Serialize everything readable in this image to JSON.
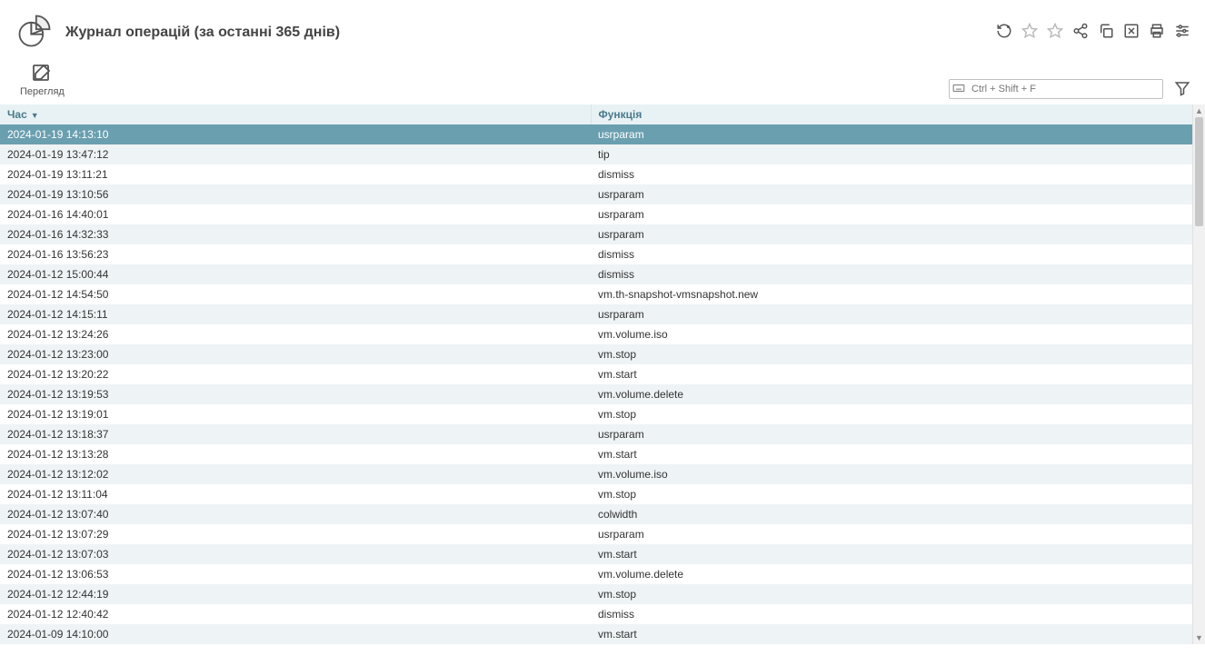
{
  "page_title": "Журнал операцій (за останні 365 днів)",
  "toolbar": {
    "view_label": "Перегляд"
  },
  "search": {
    "placeholder": "Ctrl + Shift + F"
  },
  "columns": {
    "time": "Час",
    "func": "Функція"
  },
  "rows": [
    {
      "time": "2024-01-19 14:13:10",
      "func": "usrparam",
      "selected": true
    },
    {
      "time": "2024-01-19 13:47:12",
      "func": "tip"
    },
    {
      "time": "2024-01-19 13:11:21",
      "func": "dismiss"
    },
    {
      "time": "2024-01-19 13:10:56",
      "func": "usrparam"
    },
    {
      "time": "2024-01-16 14:40:01",
      "func": "usrparam"
    },
    {
      "time": "2024-01-16 14:32:33",
      "func": "usrparam"
    },
    {
      "time": "2024-01-16 13:56:23",
      "func": "dismiss"
    },
    {
      "time": "2024-01-12 15:00:44",
      "func": "dismiss"
    },
    {
      "time": "2024-01-12 14:54:50",
      "func": "vm.th-snapshot-vmsnapshot.new"
    },
    {
      "time": "2024-01-12 14:15:11",
      "func": "usrparam"
    },
    {
      "time": "2024-01-12 13:24:26",
      "func": "vm.volume.iso"
    },
    {
      "time": "2024-01-12 13:23:00",
      "func": "vm.stop"
    },
    {
      "time": "2024-01-12 13:20:22",
      "func": "vm.start"
    },
    {
      "time": "2024-01-12 13:19:53",
      "func": "vm.volume.delete"
    },
    {
      "time": "2024-01-12 13:19:01",
      "func": "vm.stop"
    },
    {
      "time": "2024-01-12 13:18:37",
      "func": "usrparam"
    },
    {
      "time": "2024-01-12 13:13:28",
      "func": "vm.start"
    },
    {
      "time": "2024-01-12 13:12:02",
      "func": "vm.volume.iso"
    },
    {
      "time": "2024-01-12 13:11:04",
      "func": "vm.stop"
    },
    {
      "time": "2024-01-12 13:07:40",
      "func": "colwidth"
    },
    {
      "time": "2024-01-12 13:07:29",
      "func": "usrparam"
    },
    {
      "time": "2024-01-12 13:07:03",
      "func": "vm.start"
    },
    {
      "time": "2024-01-12 13:06:53",
      "func": "vm.volume.delete"
    },
    {
      "time": "2024-01-12 12:44:19",
      "func": "vm.stop"
    },
    {
      "time": "2024-01-12 12:40:42",
      "func": "dismiss"
    },
    {
      "time": "2024-01-09 14:10:00",
      "func": "vm.start"
    }
  ]
}
